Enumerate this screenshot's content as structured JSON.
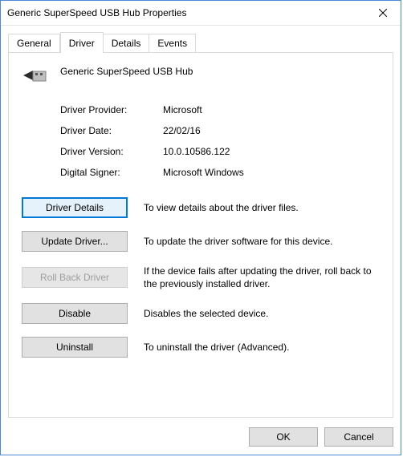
{
  "window": {
    "title": "Generic SuperSpeed USB Hub Properties"
  },
  "tabs": {
    "general": "General",
    "driver": "Driver",
    "details": "Details",
    "events": "Events",
    "active": "driver"
  },
  "device": {
    "name": "Generic SuperSpeed USB Hub"
  },
  "info": {
    "provider_label": "Driver Provider:",
    "provider_value": "Microsoft",
    "date_label": "Driver Date:",
    "date_value": "22/02/16",
    "version_label": "Driver Version:",
    "version_value": "10.0.10586.122",
    "signer_label": "Digital Signer:",
    "signer_value": "Microsoft Windows"
  },
  "actions": {
    "driver_details": {
      "label": "Driver Details",
      "desc": "To view details about the driver files."
    },
    "update_driver": {
      "label": "Update Driver...",
      "desc": "To update the driver software for this device."
    },
    "roll_back": {
      "label": "Roll Back Driver",
      "desc": "If the device fails after updating the driver, roll back to the previously installed driver."
    },
    "disable": {
      "label": "Disable",
      "desc": "Disables the selected device."
    },
    "uninstall": {
      "label": "Uninstall",
      "desc": "To uninstall the driver (Advanced)."
    }
  },
  "dialog": {
    "ok": "OK",
    "cancel": "Cancel"
  }
}
